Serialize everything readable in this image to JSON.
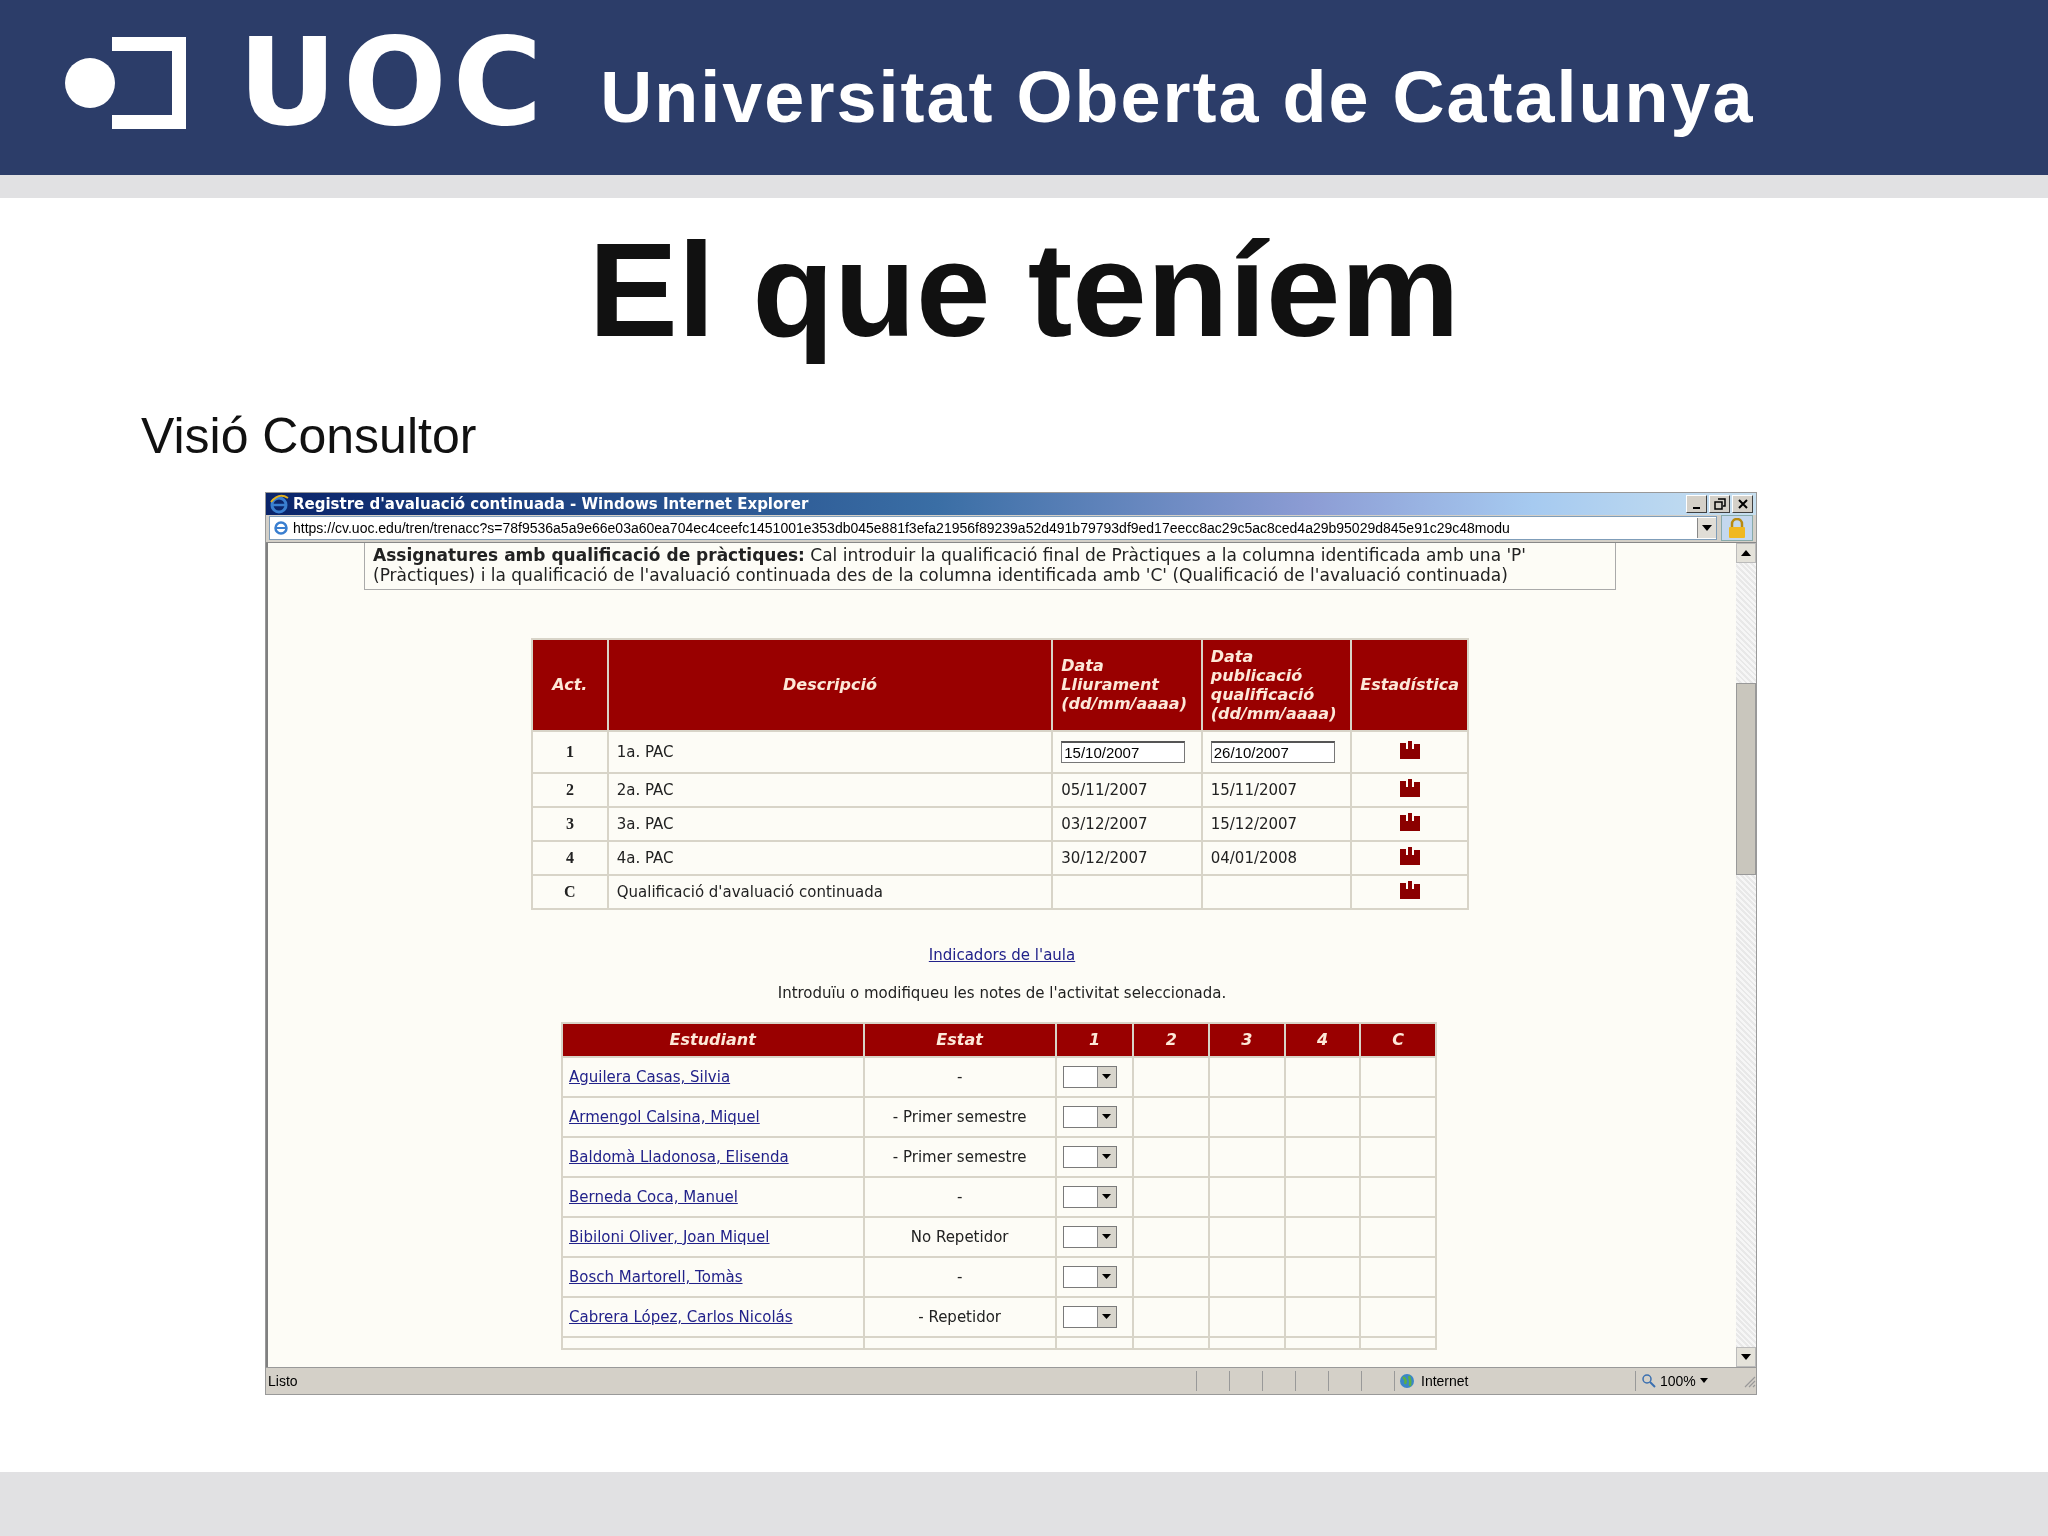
{
  "slide": {
    "logo_text": "UOC",
    "institution": "Universitat Oberta de Catalunya",
    "title": "El que teníem",
    "subtitle": "Visió Consultor"
  },
  "browser": {
    "title": "Registre d'avaluació continuada - Windows Internet Explorer",
    "address": "https://cv.uoc.edu/tren/trenacc?s=78f9536a5a9e66e03a60ea704ec4ceefc1451001e353db045e881f3efa21956f89239a52d491b79793df9ed17eecc8ac29c5ac8ced4a29b95029d845e91c29c48modu",
    "notice": "**Assignatures amb qualificació de pràctiques:** Cal introduir la qualificació final de Pràctiques a la columna identificada amb una 'P' (Pràctiques) i la qualificació de l'avaluació continuada des de la columna identificada amb 'C' (Qualificació de l'avaluació continuada)",
    "activities": {
      "columns": [
        "Act.",
        "Descripció",
        "Data Lliurament (dd/mm/aaaa)",
        "Data publicació qualificació (dd/mm/aaaa)",
        "Estadística"
      ],
      "rows": [
        {
          "act": "1",
          "description": "1a. PAC",
          "delivery_date": "15/10/2007",
          "publication_date": "26/10/2007",
          "editable": true
        },
        {
          "act": "2",
          "description": "2a. PAC",
          "delivery_date": "05/11/2007",
          "publication_date": "15/11/2007",
          "editable": false
        },
        {
          "act": "3",
          "description": "3a. PAC",
          "delivery_date": "03/12/2007",
          "publication_date": "15/12/2007",
          "editable": false
        },
        {
          "act": "4",
          "description": "4a. PAC",
          "delivery_date": "30/12/2007",
          "publication_date": "04/01/2008",
          "editable": false
        },
        {
          "act": "C",
          "description": "Qualificació d'avaluació continuada"
        }
      ]
    },
    "indicators_link": "Indicadors de l'aula",
    "instruction": "Introduïu o modifiqueu les notes de l'activitat seleccionada.",
    "students": {
      "columns": [
        "Estudiant",
        "Estat",
        "1",
        "2",
        "3",
        "4",
        "C"
      ],
      "rows": [
        {
          "name": "Aguilera Casas, Silvia",
          "status": "-"
        },
        {
          "name": "Armengol Calsina, Miquel",
          "status": "- Primer semestre"
        },
        {
          "name": "Baldomà Lladonosa, Elisenda",
          "status": "- Primer semestre"
        },
        {
          "name": "Berneda Coca, Manuel",
          "status": "-"
        },
        {
          "name": "Bibiloni Oliver, Joan Miquel",
          "status": "No Repetidor"
        },
        {
          "name": "Bosch Martorell, Tomàs",
          "status": "-"
        },
        {
          "name": "Cabrera López, Carlos Nicolás",
          "status": "- Repetidor"
        }
      ]
    },
    "status_bar": {
      "text": "Listo",
      "zone": "Internet",
      "zoom": "100%"
    }
  }
}
